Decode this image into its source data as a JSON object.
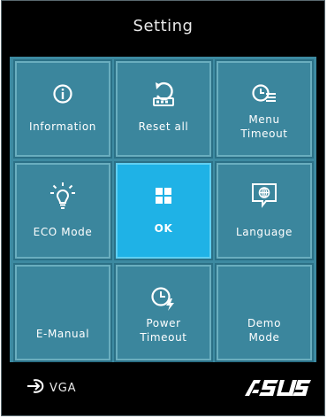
{
  "header": {
    "title": "Setting"
  },
  "menu": {
    "tiles": [
      {
        "label": "Information",
        "icon": "info-icon"
      },
      {
        "label": "Reset all",
        "icon": "reset-icon"
      },
      {
        "label": "Menu\nTimeout",
        "icon": "menu-timeout-icon"
      },
      {
        "label": "ECO Mode",
        "icon": "bulb-icon"
      },
      {
        "label": "OK",
        "icon": "ok-grid-icon",
        "selected": true
      },
      {
        "label": "Language",
        "icon": "language-icon"
      },
      {
        "label": "E-Manual",
        "icon": ""
      },
      {
        "label": "Power\nTimeout",
        "icon": "power-timeout-icon"
      },
      {
        "label": "Demo\nMode",
        "icon": ""
      }
    ]
  },
  "footer": {
    "input_label": "VGA",
    "input_icon": "input-source-icon",
    "brand": "ASUS"
  },
  "colors": {
    "tile": "#3b869d",
    "tile_selected": "#1fb2e6",
    "background": "#000000",
    "text": "#ffffff"
  }
}
